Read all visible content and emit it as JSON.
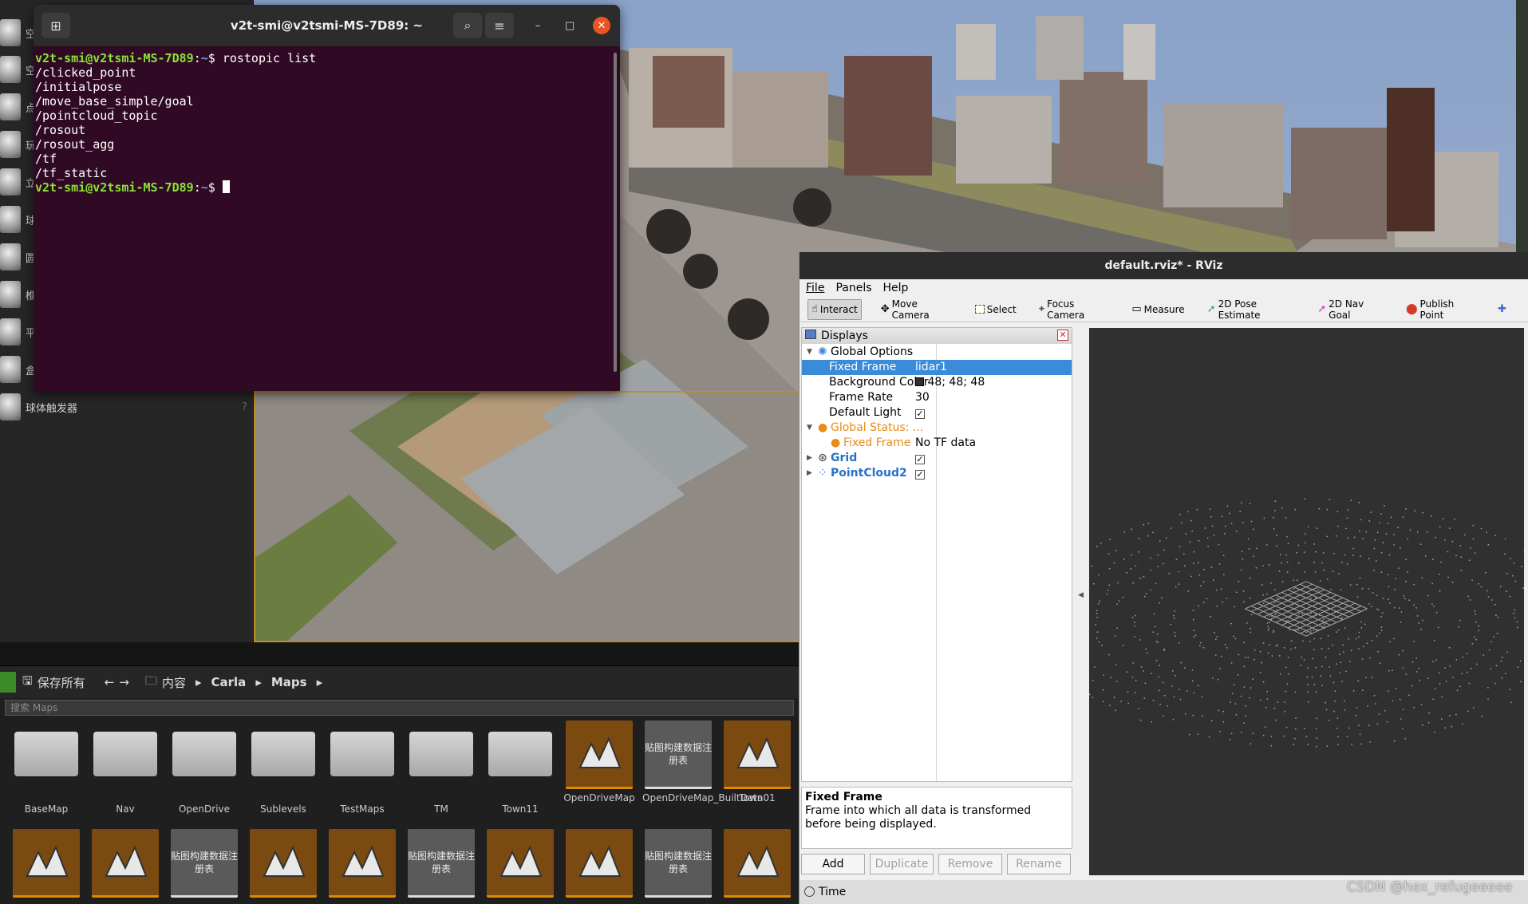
{
  "terminal": {
    "title": "v2t-smi@v2tsmi-MS-7D89: ~",
    "prompt_user": "v2t-smi@v2tsmi-MS-7D89",
    "prompt_path": "~",
    "prompt_symbol": "$",
    "command": "rostopic list",
    "output_lines": [
      "/clicked_point",
      "/initialpose",
      "/move_base_simple/goal",
      "/pointcloud_topic",
      "/rosout",
      "/rosout_agg",
      "/tf",
      "/tf_static"
    ]
  },
  "ue_place_actors": {
    "items": [
      {
        "label": "空"
      },
      {
        "label": "空"
      },
      {
        "label": "点"
      },
      {
        "label": "玩"
      },
      {
        "label": "立"
      },
      {
        "label": "球"
      },
      {
        "label": "圆"
      },
      {
        "label": "椎"
      },
      {
        "label": "平"
      },
      {
        "label": "盒"
      },
      {
        "label": "球体触发器"
      }
    ]
  },
  "content_browser": {
    "save_all": "保存所有",
    "breadcrumb": [
      "内容",
      "Carla",
      "Maps"
    ],
    "search_placeholder": "搜索 Maps",
    "row1": [
      {
        "kind": "folder",
        "label": "BaseMap"
      },
      {
        "kind": "folder",
        "label": "Nav"
      },
      {
        "kind": "folder",
        "label": "OpenDrive"
      },
      {
        "kind": "folder",
        "label": "Sublevels"
      },
      {
        "kind": "folder",
        "label": "TestMaps"
      },
      {
        "kind": "folder",
        "label": "TM"
      },
      {
        "kind": "folder",
        "label": "Town11"
      },
      {
        "kind": "map",
        "label": "OpenDriveMap"
      },
      {
        "kind": "registry",
        "text": "贴图构建数据注册表",
        "label": "OpenDriveMap_BuiltData"
      },
      {
        "kind": "map",
        "label": "Town01"
      }
    ],
    "row2": [
      {
        "kind": "map"
      },
      {
        "kind": "map"
      },
      {
        "kind": "registry",
        "text": "贴图构建数据注册表"
      },
      {
        "kind": "map"
      },
      {
        "kind": "map"
      },
      {
        "kind": "registry",
        "text": "贴图构建数据注册表"
      },
      {
        "kind": "map"
      },
      {
        "kind": "map"
      },
      {
        "kind": "registry",
        "text": "贴图构建数据注册表"
      },
      {
        "kind": "map"
      }
    ]
  },
  "rviz": {
    "title": "default.rviz* - RViz",
    "menu": [
      "File",
      "Panels",
      "Help"
    ],
    "tools": [
      {
        "label": "Interact",
        "icon": "hand-icon",
        "active": true
      },
      {
        "label": "Move Camera",
        "icon": "move-camera-icon"
      },
      {
        "label": "Select",
        "icon": "select-icon"
      },
      {
        "label": "Focus Camera",
        "icon": "focus-camera-icon"
      },
      {
        "label": "Measure",
        "icon": "measure-icon"
      },
      {
        "label": "2D Pose Estimate",
        "icon": "pose-estimate-icon"
      },
      {
        "label": "2D Nav Goal",
        "icon": "nav-goal-icon"
      },
      {
        "label": "Publish Point",
        "icon": "publish-point-icon"
      }
    ],
    "displays_title": "Displays",
    "tree": {
      "global_options": "Global Options",
      "fixed_frame_label": "Fixed Frame",
      "fixed_frame_value": "lidar1",
      "bg_color_label": "Background Color",
      "bg_color_value": "48; 48; 48",
      "frame_rate_label": "Frame Rate",
      "frame_rate_value": "30",
      "default_light_label": "Default Light",
      "global_status": "Global Status: ...",
      "status_fixed_frame": "Fixed Frame",
      "status_fixed_frame_value": "No TF data",
      "grid": "Grid",
      "pointcloud": "PointCloud2"
    },
    "help_title": "Fixed Frame",
    "help_text": "Frame into which all data is transformed before being displayed.",
    "buttons": [
      "Add",
      "Duplicate",
      "Remove",
      "Rename"
    ],
    "time_label": "Time",
    "colors": {
      "background": "#303030",
      "warning": "#e88a14",
      "selection": "#3a8bd8"
    }
  },
  "watermark": "CSDN @hex_refugeeeee"
}
